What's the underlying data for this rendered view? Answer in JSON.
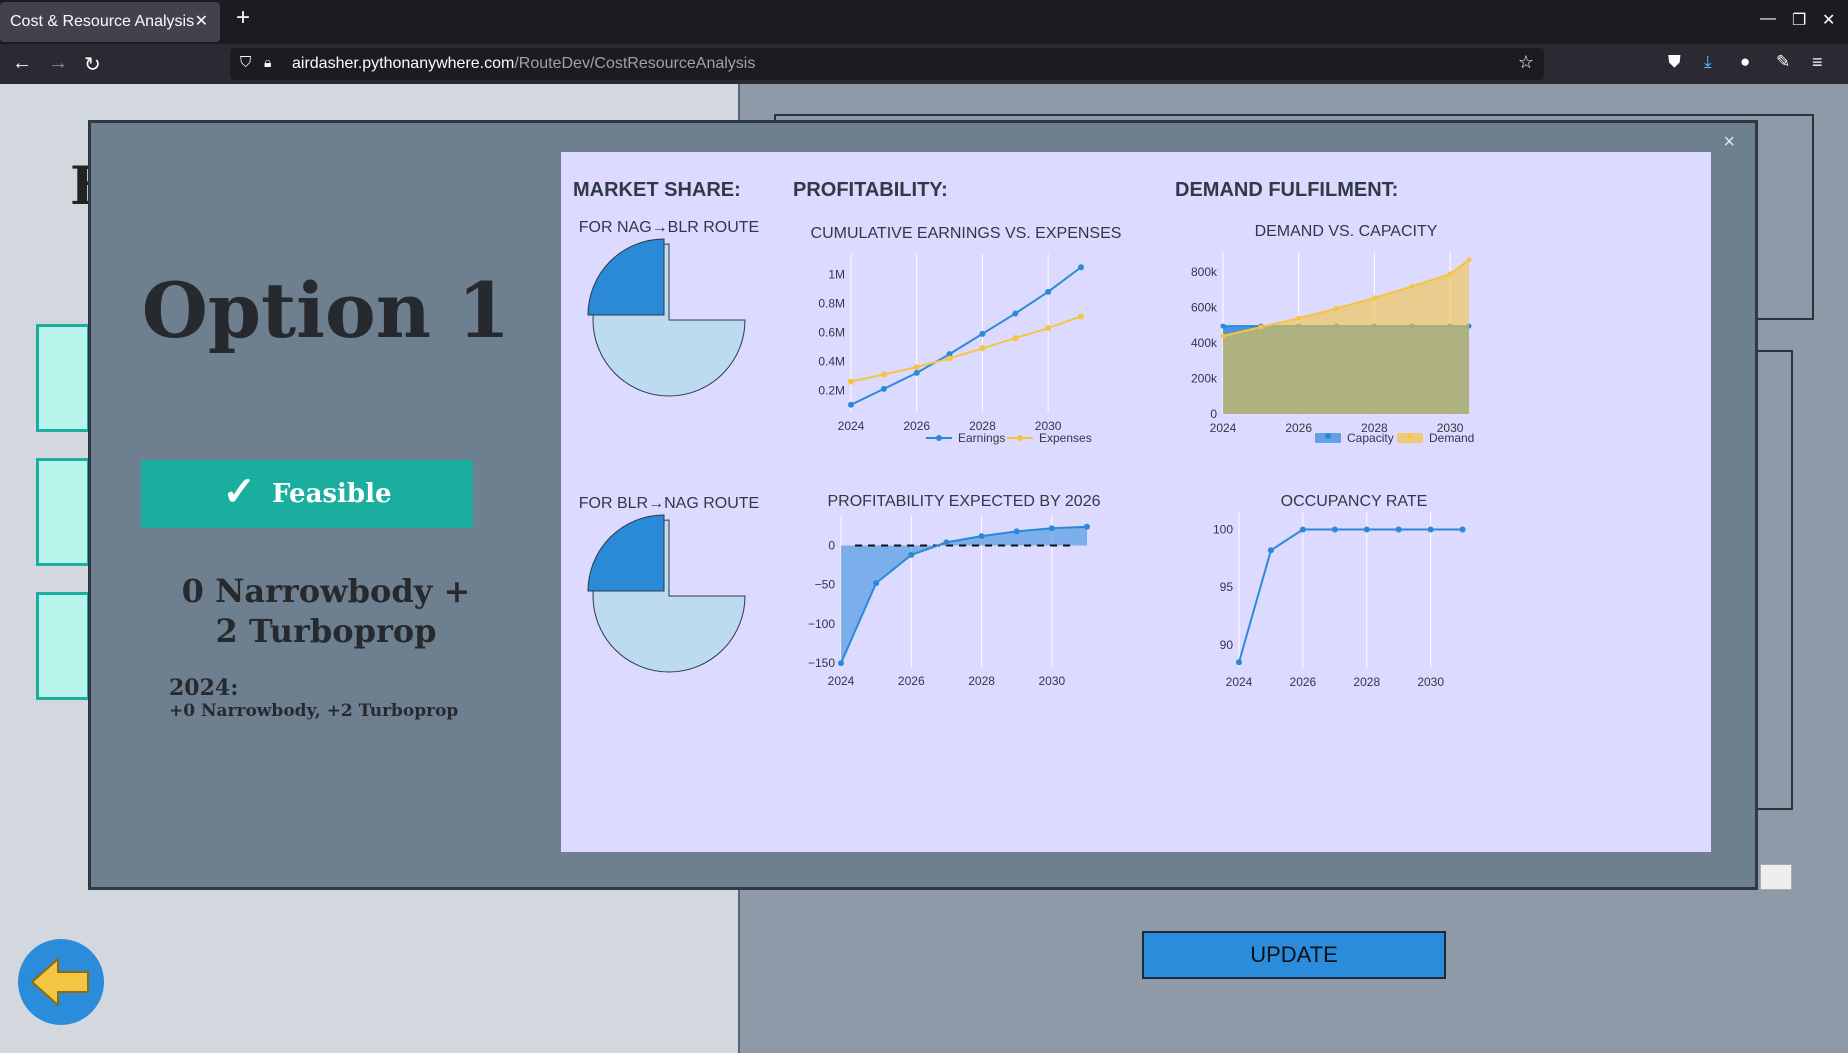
{
  "browser": {
    "tab_title": "Cost & Resource Analysis",
    "url_domain": "airdasher.pythonanywhere.com",
    "url_path": "/RouteDev/CostResourceAnalysis"
  },
  "background": {
    "title_initial": "F",
    "update_label": "UPDATE"
  },
  "modal": {
    "close_label": "×",
    "option_title": "Option 1",
    "feasible_check": "✓",
    "feasible_label": "Feasible",
    "fleet_summary_line1": "0 Narrowbody +",
    "fleet_summary_line2": "2 Turboprop",
    "schedule_year": "2024:",
    "schedule_detail": "+0 Narrowbody, +2 Turboprop"
  },
  "sections": {
    "market_share": "MARKET SHARE:",
    "profitability": "PROFITABILITY:",
    "demand": "DEMAND FULFILMENT:"
  },
  "colors": {
    "blue": "#2b8ad8",
    "light_blue": "#bcdaf0",
    "orange": "#f4c542",
    "teal": "#1aae9f"
  },
  "chart_data": [
    {
      "id": "market_share_nag_blr",
      "type": "pie",
      "title": "FOR NAG→BLR ROUTE",
      "values": [
        25,
        75
      ]
    },
    {
      "id": "market_share_blr_nag",
      "type": "pie",
      "title": "FOR BLR→NAG ROUTE",
      "values": [
        25,
        75
      ]
    },
    {
      "id": "cumulative",
      "type": "line",
      "title": "CUMULATIVE EARNINGS VS. EXPENSES",
      "x": [
        2024,
        2025,
        2026,
        2027,
        2028,
        2029,
        2030,
        2031
      ],
      "series": [
        {
          "name": "Earnings",
          "values": [
            0.1,
            0.21,
            0.32,
            0.45,
            0.59,
            0.73,
            0.88,
            1.05
          ]
        },
        {
          "name": "Expenses",
          "values": [
            0.26,
            0.31,
            0.36,
            0.42,
            0.49,
            0.56,
            0.63,
            0.71
          ]
        }
      ],
      "xticks": [
        "2024",
        "2026",
        "2028",
        "2030"
      ],
      "yticks": [
        "0.2M",
        "0.4M",
        "0.6M",
        "0.8M",
        "1M"
      ],
      "ylim": [
        0.05,
        1.1
      ]
    },
    {
      "id": "demand_capacity",
      "type": "area",
      "title": "DEMAND VS. CAPACITY",
      "x": [
        2024,
        2025,
        2026,
        2027,
        2028,
        2029,
        2030,
        2031
      ],
      "series": [
        {
          "name": "Capacity",
          "values": [
            496000,
            496000,
            496000,
            496000,
            496000,
            496000,
            496000,
            496000
          ]
        },
        {
          "name": "Demand",
          "values": [
            440000,
            490000,
            540000,
            595000,
            655000,
            720000,
            790000,
            870000
          ]
        }
      ],
      "xticks": [
        "2024",
        "2026",
        "2028",
        "2030"
      ],
      "yticks": [
        "0",
        "200k",
        "400k",
        "600k",
        "800k"
      ],
      "ylim": [
        0,
        880000
      ]
    },
    {
      "id": "profitability_2026",
      "type": "area",
      "title": "PROFITABILITY EXPECTED BY 2026",
      "x": [
        2024,
        2025,
        2026,
        2027,
        2028,
        2029,
        2030,
        2031
      ],
      "series": [
        {
          "values": [
            -150,
            -48,
            -12,
            4,
            12,
            18,
            22,
            24
          ]
        }
      ],
      "xticks": [
        "2024",
        "2026",
        "2028",
        "2030"
      ],
      "yticks": [
        "−150",
        "−100",
        "−50",
        "0"
      ],
      "ylim": [
        -155,
        30
      ]
    },
    {
      "id": "occupancy",
      "type": "line",
      "title": "OCCUPANCY RATE",
      "x": [
        2024,
        2025,
        2026,
        2027,
        2028,
        2029,
        2030,
        2031
      ],
      "series": [
        {
          "values": [
            88.5,
            98.2,
            100,
            100,
            100,
            100,
            100,
            100
          ]
        }
      ],
      "xticks": [
        "2024",
        "2026",
        "2028",
        "2030"
      ],
      "yticks": [
        "90",
        "95",
        "100"
      ],
      "ylim": [
        88,
        101
      ]
    }
  ]
}
